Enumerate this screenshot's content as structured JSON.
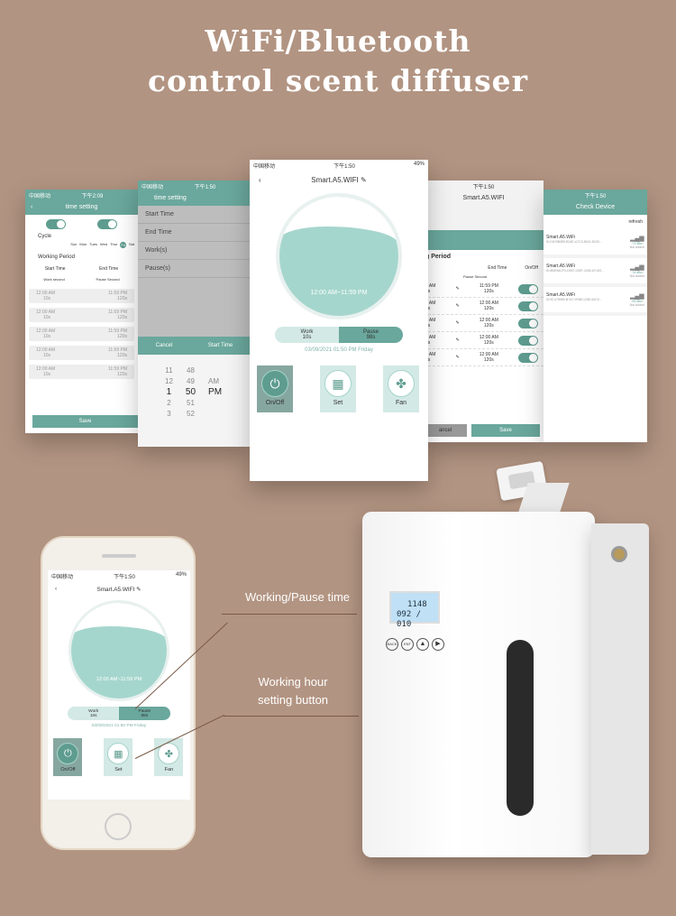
{
  "headline": {
    "line1": "WiFi/Bluetooth",
    "line2": "control scent diffuser"
  },
  "colors": {
    "background": "#b29482",
    "accent": "#6aa79c",
    "wave": "#a5d6cd"
  },
  "status_bar": {
    "carrier": "中国移动",
    "time": "下午1:50",
    "time_alt": "下午2:09",
    "battery": "49%"
  },
  "screen_time_setting": {
    "title": "time setting",
    "cycle_label": "Cycle",
    "days": [
      "Sun",
      "Mon",
      "Tues",
      "Wed",
      "Thur",
      "Fri",
      "Sat"
    ],
    "selected_day": "Fri",
    "period_label": "Working Period",
    "start_time": "Start Time",
    "end_time": "End Time",
    "work_second": "Work second",
    "pause_second": "Pause Second",
    "rows": [
      {
        "start": "12:00 AM",
        "end": "11:59 PM",
        "work": "10s",
        "pause": "120s"
      },
      {
        "start": "12:00 AM",
        "end": "11:59 PM",
        "work": "10s",
        "pause": "120s"
      },
      {
        "start": "12:00 AM",
        "end": "11:59 PM",
        "work": "10s",
        "pause": "120s"
      },
      {
        "start": "12:00 AM",
        "end": "11:59 PM",
        "work": "10s",
        "pause": "120s"
      },
      {
        "start": "12:00 AM",
        "end": "11:59 PM",
        "work": "10s",
        "pause": "120s"
      }
    ],
    "save": "Save"
  },
  "screen_picker": {
    "title": "time setting",
    "fields": [
      "Start Time",
      "End Time",
      "Work(s)",
      "Pause(s)"
    ],
    "cancel": "Cancel",
    "picker_title": "Start Time",
    "hours": [
      "11",
      "12",
      "1",
      "2",
      "3"
    ],
    "minutes": [
      "48",
      "49",
      "50",
      "51",
      "52"
    ],
    "ampm": [
      "AM",
      "PM"
    ],
    "selected": {
      "hour": "1",
      "minute": "50",
      "ampm": "PM"
    }
  },
  "screen_main": {
    "device": "Smart.A5.WIFI",
    "time_range": "12:00 AM~11:59 PM",
    "work_label": "Work",
    "work_value": "10s",
    "pause_label": "Pause",
    "pause_value": "98s",
    "datetime": "03/09/2021 01:50 PM Friday",
    "buttons": [
      {
        "label": "On/Off",
        "icon": "power-icon"
      },
      {
        "label": "Set",
        "icon": "grid-icon"
      },
      {
        "label": "Fan",
        "icon": "fan-icon"
      }
    ]
  },
  "screen_period": {
    "device": "Smart.A5.WIFI",
    "period_label": "g Period",
    "end_time": "End Time",
    "onoff": "On/Off",
    "pause_second": "Pause Second",
    "rows": [
      {
        "start": "0 AM",
        "work": "0s",
        "end": "11:59 PM",
        "pause": "120s"
      },
      {
        "start": "0 AM",
        "work": "0s",
        "end": "12:00 AM",
        "pause": "120s"
      },
      {
        "start": "0 AM",
        "work": "0s",
        "end": "12:00 AM",
        "pause": "120s"
      },
      {
        "start": "0 AM",
        "work": "0s",
        "end": "12:00 AM",
        "pause": "120s"
      },
      {
        "start": "0 AM",
        "work": "0s",
        "end": "12:00 AM",
        "pause": "120s"
      }
    ],
    "cancel": "ancel",
    "save": "Save"
  },
  "screen_check": {
    "title": "Check Device",
    "refresh": "refresh",
    "devices": [
      {
        "name": "Smart.A5.WiFi",
        "id": "ID:01D9B389-B24E-A7C3-8041-8C00...",
        "signal": "-74 dBm",
        "status": "Not Added"
      },
      {
        "name": "Smart.A5.WiFi",
        "id": "ID:8BE9ACF0-D897-030F-2405-6Y183...",
        "signal": "-76 dBm",
        "status": "Not Added"
      },
      {
        "name": "Smart.A5.WiFi",
        "id": "ID:9C478989-B7A7-9F6B-126E-64C9...",
        "signal": "-95 dBm",
        "status": "Not Added"
      }
    ]
  },
  "callouts": {
    "pause": "Working/Pause time",
    "set_line1": "Working hour",
    "set_line2": "setting button"
  },
  "device_panel": {
    "lcd_line1": "1148",
    "lcd_line2": "092 / 010",
    "buttons": [
      "BACK",
      "ENT"
    ]
  }
}
